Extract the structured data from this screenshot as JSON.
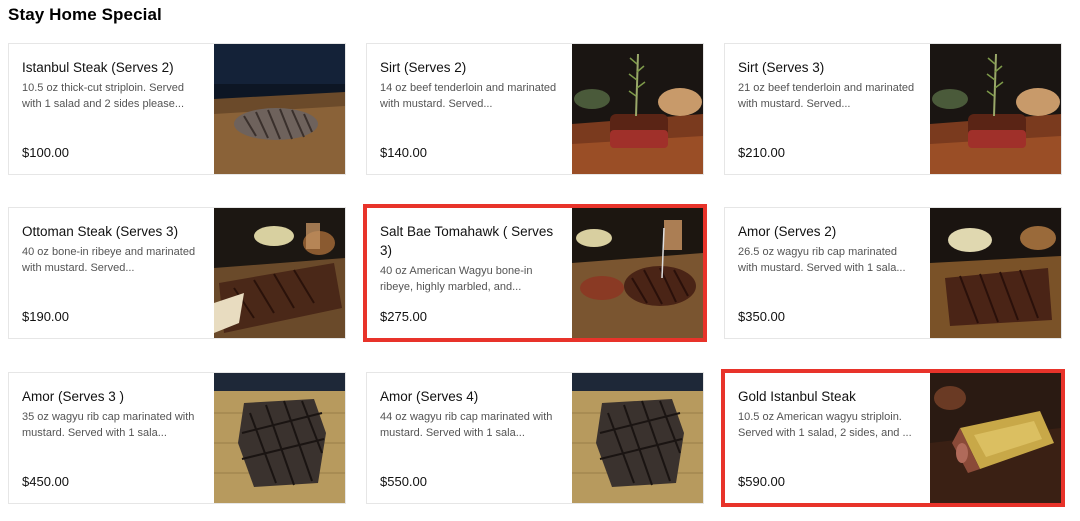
{
  "section": {
    "title": "Stay Home Special"
  },
  "items": [
    {
      "name": "Istanbul Steak (Serves 2)",
      "desc": "10.5 oz thick-cut striploin. Served with 1 salad and 2 sides please...",
      "price": "$100.00",
      "image": "steak-on-board-photo",
      "highlighted": false
    },
    {
      "name": "Sirt (Serves 2)",
      "desc": "14 oz beef tenderloin and marinated with mustard. Served...",
      "price": "$140.00",
      "image": "tenderloin-rosemary-photo",
      "highlighted": false
    },
    {
      "name": "Sirt (Serves 3)",
      "desc": "21 oz beef tenderloin and marinated with mustard. Served...",
      "price": "$210.00",
      "image": "tenderloin-rosemary-photo",
      "highlighted": false
    },
    {
      "name": "Ottoman Steak (Serves 3)",
      "desc": "40 oz bone-in ribeye and marinated with mustard. Served...",
      "price": "$190.00",
      "image": "bone-in-ribeye-photo",
      "highlighted": false
    },
    {
      "name": "Salt Bae Tomahawk ( Serves 3)",
      "desc": "40 oz American Wagyu bone-in ribeye, highly marbled, and...",
      "price": "$275.00",
      "image": "tomahawk-photo",
      "highlighted": true
    },
    {
      "name": "Amor (Serves 2)",
      "desc": "26.5 oz wagyu rib cap marinated with mustard. Served with 1 sala...",
      "price": "$350.00",
      "image": "rib-cap-board-photo",
      "highlighted": false
    },
    {
      "name": "Amor (Serves 3 )",
      "desc": "35 oz wagyu rib cap marinated with mustard. Served with 1 sala...",
      "price": "$450.00",
      "image": "grilled-steak-wood-photo",
      "highlighted": false
    },
    {
      "name": "Amor (Serves 4)",
      "desc": "44 oz wagyu rib cap marinated with mustard. Served with 1 sala...",
      "price": "$550.00",
      "image": "grilled-steak-wood-photo",
      "highlighted": false
    },
    {
      "name": "Gold Istanbul Steak",
      "desc": "10.5 oz American wagyu striploin. Served with 1 salad, 2 sides, and ...",
      "price": "$590.00",
      "image": "gold-leaf-steak-photo",
      "highlighted": true
    }
  ],
  "colors": {
    "highlight": "#e8332a",
    "border": "#e6e6e6",
    "desc": "#545454"
  }
}
